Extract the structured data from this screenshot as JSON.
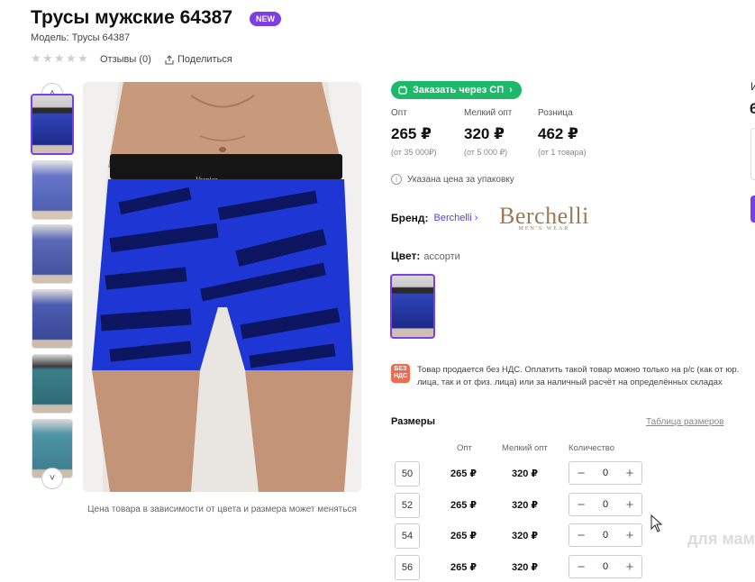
{
  "product": {
    "title": "Трусы мужские 64387",
    "badge": "NEW",
    "model": "Модель: Трусы 64387",
    "reviews": "Отзывы (0)",
    "share": "Поделиться"
  },
  "gallery": {
    "caption": "Цена товара в зависимости от цвета и размера может меняться"
  },
  "purchase": {
    "sp_button": "Заказать через СП",
    "prices": [
      {
        "label": "Опт",
        "value": "265 ₽",
        "sub": "(от 35 000₽)"
      },
      {
        "label": "Мелкий опт",
        "value": "320 ₽",
        "sub": "(от 5 000 ₽)"
      },
      {
        "label": "Розница",
        "value": "462 ₽",
        "sub": "(от 1 товара)"
      }
    ],
    "package_note": "Указана цена за упаковку"
  },
  "brand": {
    "label": "Бренд:",
    "name": "Berchelli",
    "logo_text": "Berchelli",
    "logo_sub": "MEN'S WEAR"
  },
  "color": {
    "label": "Цвет:",
    "value": "ассорти"
  },
  "vat": {
    "icon": "БЕЗ НДС",
    "text": "Товар продается без НДС. Оплатить такой товар можно только на р/с (как от юр. лица, так и от физ. лица) или за наличный расчёт на определённых складах"
  },
  "sizes": {
    "title": "Размеры",
    "table_link": "Таблица размеров",
    "headers": {
      "opt": "Опт",
      "small_opt": "Мелкий опт",
      "qty": "Количество"
    },
    "rows": [
      {
        "size": "50",
        "opt": "265 ₽",
        "small_opt": "320 ₽",
        "qty": "0"
      },
      {
        "size": "52",
        "opt": "265 ₽",
        "small_opt": "320 ₽",
        "qty": "0"
      },
      {
        "size": "54",
        "opt": "265 ₽",
        "small_opt": "320 ₽",
        "qty": "0"
      },
      {
        "size": "56",
        "opt": "265 ₽",
        "small_opt": "320 ₽",
        "qty": "0"
      }
    ]
  },
  "edge": {
    "partial_letter": "И",
    "partial_price": "6"
  },
  "watermark": "для мам",
  "colors": {
    "accent": "#7b3fe4",
    "green": "#1eb86b",
    "vat": "#f06a4d"
  }
}
